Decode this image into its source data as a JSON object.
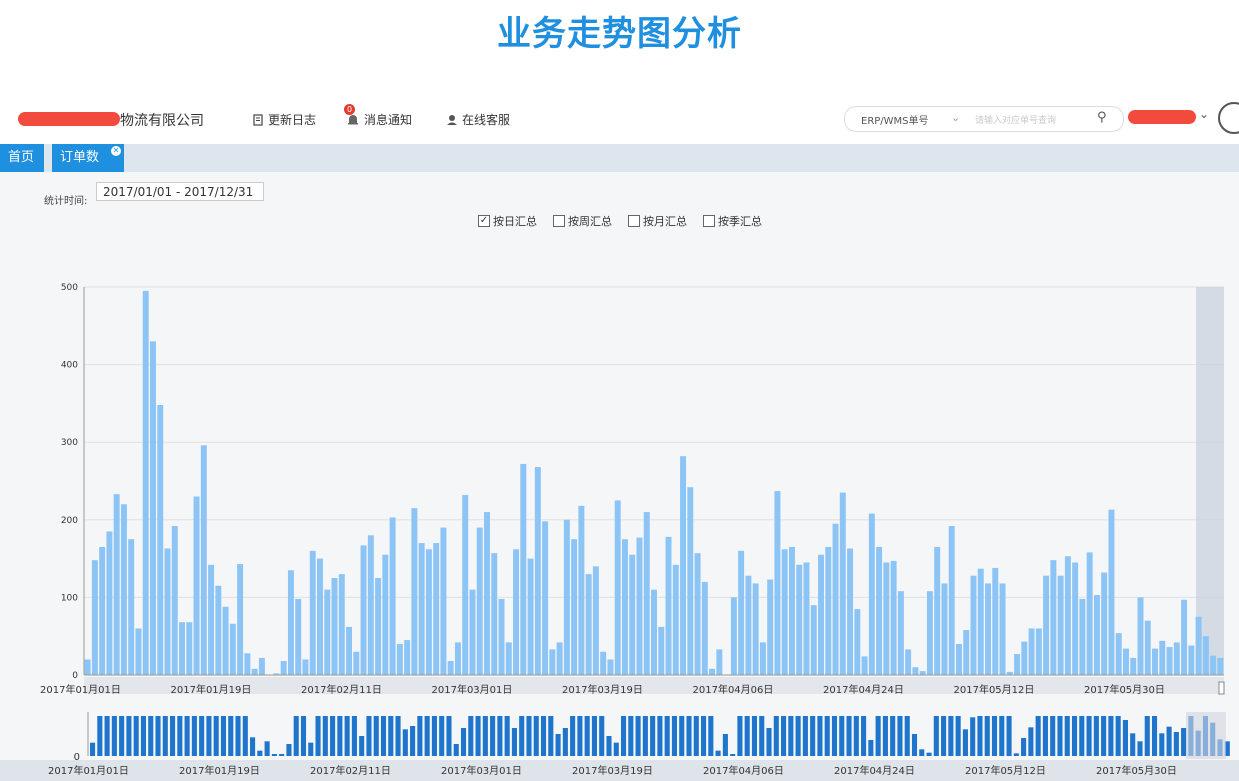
{
  "page_title": "业务走势图分析",
  "header": {
    "company_name": "物流有限公司",
    "nav": [
      {
        "label": "更新日志",
        "icon": "document-icon"
      },
      {
        "label": "消息通知",
        "icon": "bell-icon",
        "badge": "0"
      },
      {
        "label": "在线客服",
        "icon": "support-icon"
      }
    ],
    "search": {
      "selector": "ERP/WMS单号",
      "placeholder": "请输入对应单号查询"
    }
  },
  "tabs": [
    {
      "label": "首页"
    },
    {
      "label": "订单数"
    }
  ],
  "filters": {
    "time_label": "统计时间:",
    "date_range": "2017/01/01 - 2017/12/31",
    "group_options": [
      {
        "label": "按日汇总",
        "checked": true
      },
      {
        "label": "按周汇总",
        "checked": false
      },
      {
        "label": "按月汇总",
        "checked": false
      },
      {
        "label": "按季汇总",
        "checked": false
      }
    ]
  },
  "colors": {
    "accent": "#1f8fe0",
    "bar": "#8cc4f5",
    "nav_bar": "#1f74cc",
    "tab_bar": "#dde5ee"
  },
  "chart_data": {
    "type": "bar",
    "title": "",
    "xlabel": "",
    "ylabel": "",
    "ylim": [
      0,
      500
    ],
    "y_ticks": [
      0,
      100,
      200,
      300,
      400,
      500
    ],
    "x_tick_labels": [
      "2017年01月01日",
      "2017年01月19日",
      "2017年02月11日",
      "2017年03月01日",
      "2017年03月19日",
      "2017年04月06日",
      "2017年04月24日",
      "2017年05月12日",
      "2017年05月30日"
    ],
    "values": [
      20,
      148,
      165,
      185,
      233,
      220,
      175,
      60,
      495,
      430,
      348,
      163,
      192,
      68,
      68,
      230,
      296,
      142,
      115,
      88,
      66,
      143,
      28,
      8,
      22,
      0,
      2,
      18,
      135,
      98,
      20,
      160,
      150,
      110,
      125,
      130,
      62,
      30,
      167,
      180,
      125,
      155,
      203,
      40,
      45,
      215,
      170,
      162,
      170,
      190,
      18,
      42,
      232,
      110,
      190,
      210,
      157,
      98,
      42,
      162,
      272,
      150,
      268,
      198,
      33,
      42,
      200,
      175,
      218,
      130,
      140,
      30,
      20,
      225,
      175,
      155,
      177,
      210,
      110,
      62,
      178,
      142,
      282,
      242,
      157,
      120,
      8,
      33,
      0,
      100,
      160,
      128,
      118,
      42,
      123,
      237,
      162,
      165,
      142,
      145,
      90,
      155,
      165,
      195,
      235,
      163,
      85,
      24,
      208,
      165,
      145,
      147,
      108,
      33,
      10,
      5,
      108,
      165,
      118,
      192,
      40,
      58,
      128,
      137,
      118,
      138,
      118,
      4,
      27,
      43,
      60,
      60,
      128,
      148,
      128,
      153,
      145,
      98,
      158,
      103,
      132,
      213,
      54,
      34,
      22,
      100,
      70,
      34,
      44,
      36,
      42,
      97,
      38,
      75,
      50,
      25,
      22
    ]
  },
  "slider": {
    "zero_label": "0",
    "x_tick_labels": [
      "2017年01月01日",
      "2017年01月19日",
      "2017年02月11日",
      "2017年03月01日",
      "2017年03月19日",
      "2017年04月06日",
      "2017年04月24日",
      "2017年05月12日",
      "2017年05月30日"
    ]
  }
}
